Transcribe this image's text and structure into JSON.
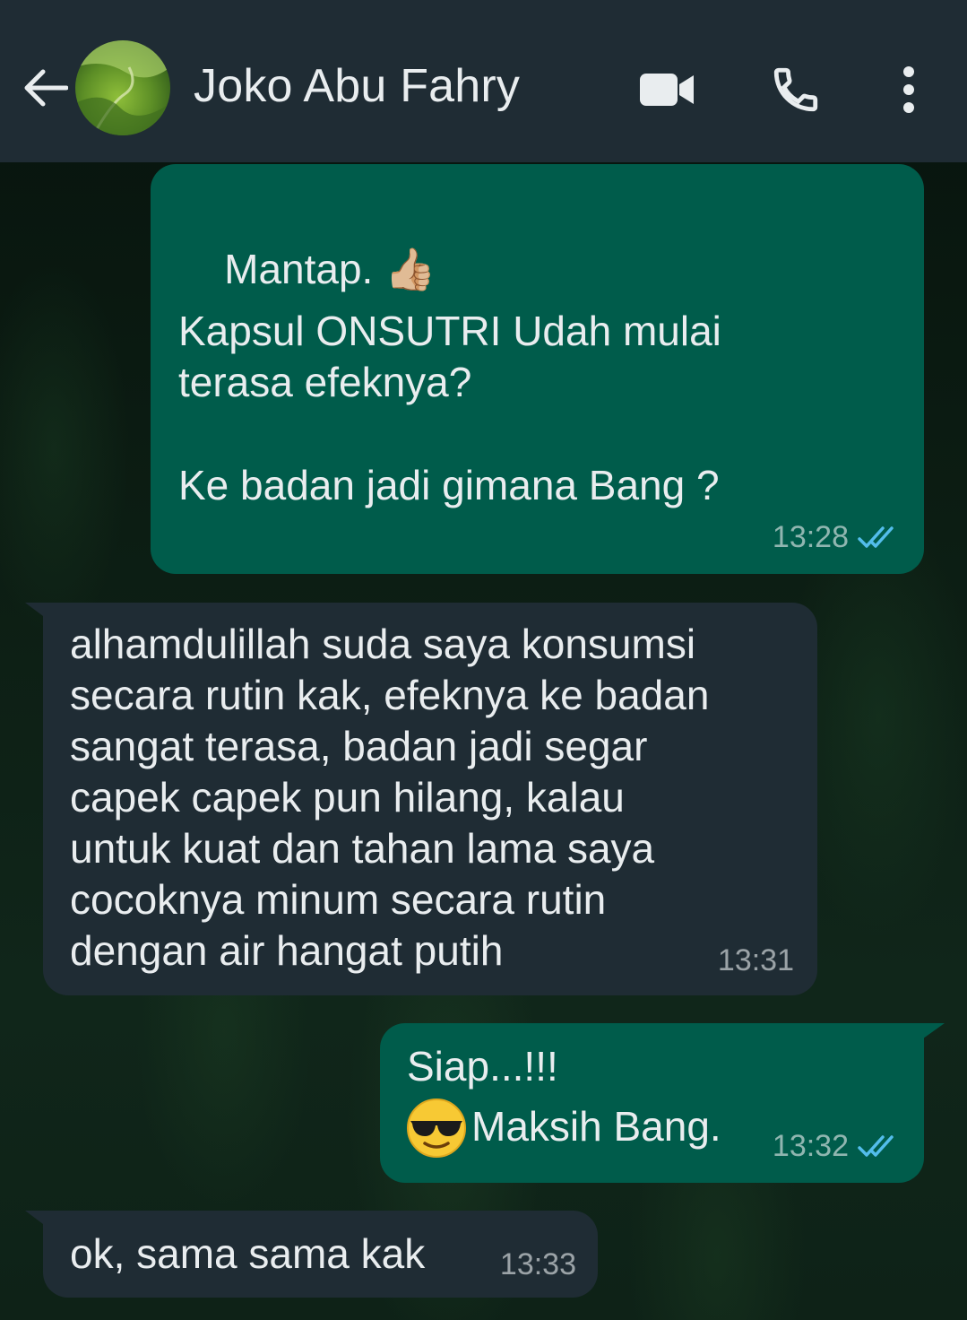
{
  "header": {
    "contact_name": "Joko Abu Fahry",
    "icons": [
      "back-arrow-icon",
      "video-call-icon",
      "phone-icon",
      "more-vertical-icon"
    ]
  },
  "colors": {
    "header_bg": "#1f2c34",
    "outgoing_bubble": "#005c4b",
    "incoming_bubble": "#1f2c34",
    "read_tick": "#53bdeb"
  },
  "messages": [
    {
      "direction": "outgoing",
      "lines": [
        "Mantap. 👍🏼",
        "",
        "Kapsul ONSUTRI Udah mulai",
        "terasa efeknya?",
        "",
        "Ke badan jadi gimana Bang ?"
      ],
      "time": "13:28",
      "status": "read"
    },
    {
      "direction": "incoming",
      "lines": [
        "alhamdulillah suda saya konsumsi",
        "secara rutin kak, efeknya ke badan",
        "sangat terasa, badan jadi segar",
        "capek capek pun hilang, kalau",
        "untuk kuat dan tahan lama saya",
        "cocoknya minum secara rutin",
        "dengan air hangat putih"
      ],
      "time": "13:31"
    },
    {
      "direction": "outgoing",
      "lines": [
        "Siap...!!!",
        "Maksih Bang."
      ],
      "emoji": "sunglasses-smiley-icon",
      "time": "13:32",
      "status": "read"
    },
    {
      "direction": "incoming",
      "lines": [
        "ok, sama sama kak"
      ],
      "time": "13:33"
    }
  ]
}
